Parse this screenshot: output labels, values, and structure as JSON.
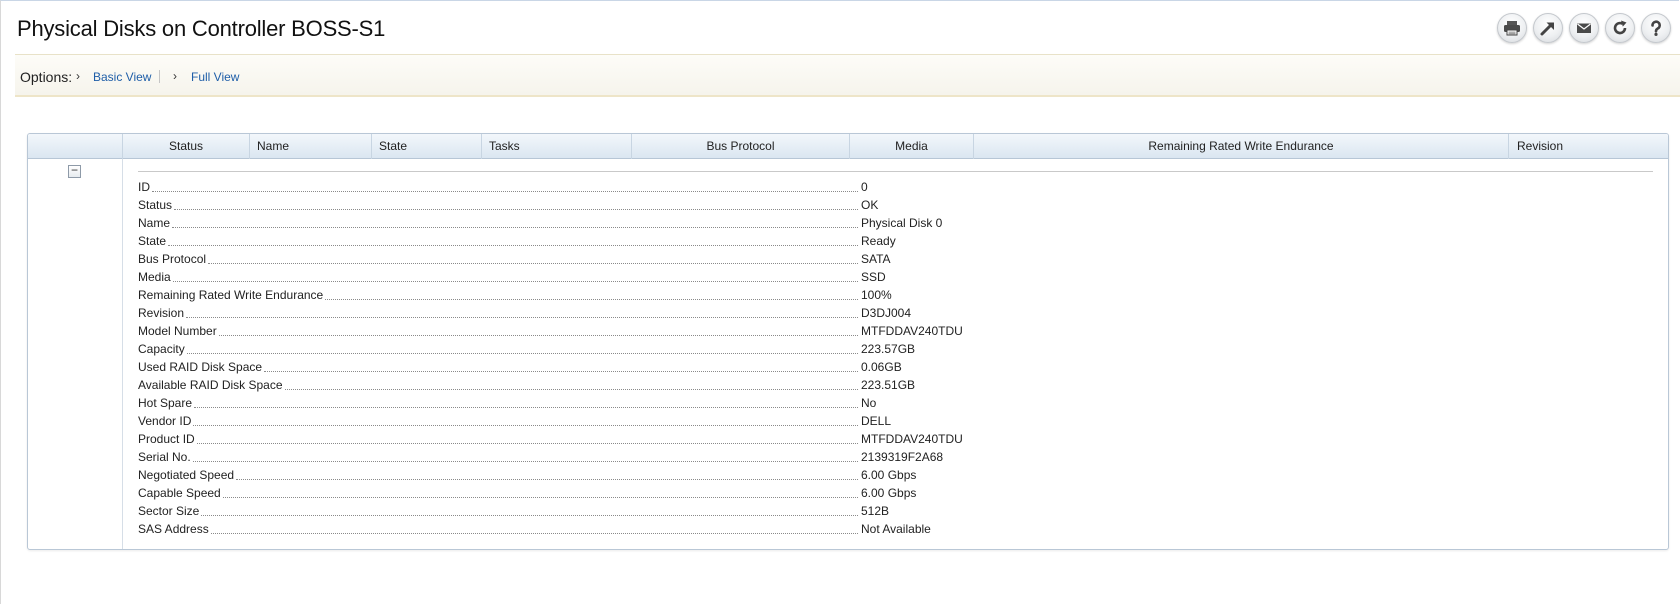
{
  "page": {
    "title": "Physical Disks on Controller BOSS-S1"
  },
  "toolbar": {
    "buttons": [
      {
        "name": "print-icon"
      },
      {
        "name": "export-icon"
      },
      {
        "name": "email-icon"
      },
      {
        "name": "refresh-icon"
      },
      {
        "name": "help-icon"
      }
    ]
  },
  "options": {
    "label": "Options:",
    "links": [
      "Basic View",
      "Full View"
    ],
    "arrow_glyph": "›"
  },
  "table": {
    "columns": [
      "Status",
      "Name",
      "State",
      "Tasks",
      "Bus Protocol",
      "Media",
      "Remaining Rated Write Endurance",
      "Revision"
    ],
    "collapse_glyph": "−",
    "details": [
      {
        "label": "ID",
        "value": "0"
      },
      {
        "label": "Status",
        "value": "OK"
      },
      {
        "label": "Name",
        "value": "Physical Disk 0"
      },
      {
        "label": "State",
        "value": "Ready"
      },
      {
        "label": "Bus Protocol",
        "value": "SATA"
      },
      {
        "label": "Media",
        "value": "SSD"
      },
      {
        "label": "Remaining Rated Write Endurance",
        "value": "100%"
      },
      {
        "label": "Revision",
        "value": "D3DJ004"
      },
      {
        "label": "Model Number",
        "value": "MTFDDAV240TDU"
      },
      {
        "label": "Capacity",
        "value": "223.57GB"
      },
      {
        "label": "Used RAID Disk Space",
        "value": "0.06GB"
      },
      {
        "label": "Available RAID Disk Space",
        "value": "223.51GB"
      },
      {
        "label": "Hot Spare",
        "value": "No"
      },
      {
        "label": "Vendor ID",
        "value": "DELL"
      },
      {
        "label": "Product ID",
        "value": "MTFDDAV240TDU"
      },
      {
        "label": "Serial No.",
        "value": "2139319F2A68"
      },
      {
        "label": "Negotiated Speed",
        "value": "6.00 Gbps"
      },
      {
        "label": "Capable Speed",
        "value": "6.00 Gbps"
      },
      {
        "label": "Sector Size",
        "value": "512B"
      },
      {
        "label": "SAS Address",
        "value": "Not Available"
      }
    ]
  }
}
